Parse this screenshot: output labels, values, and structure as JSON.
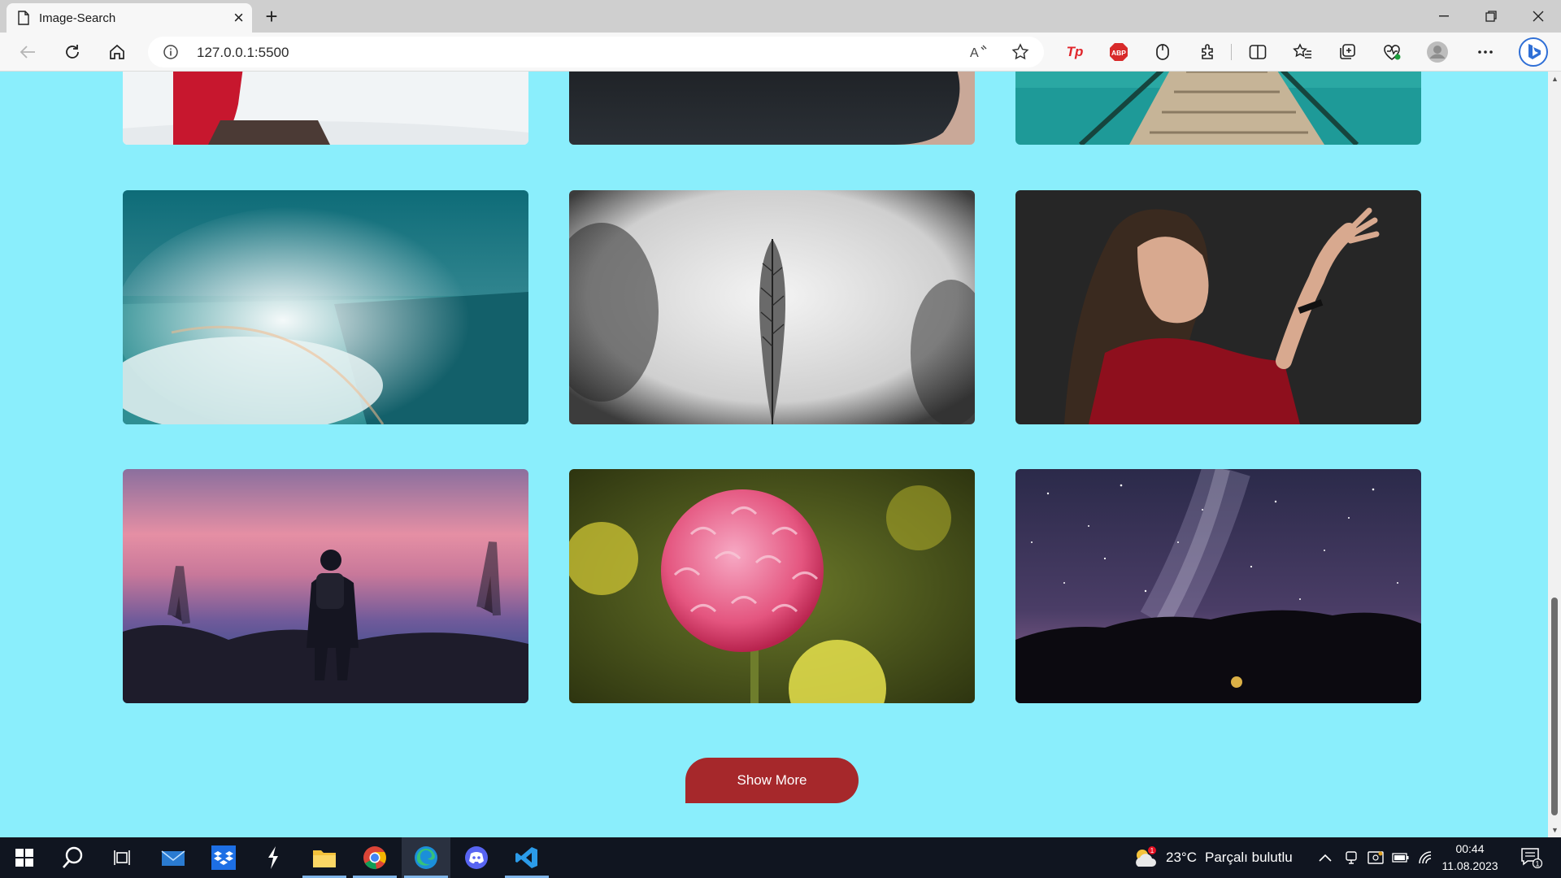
{
  "browser": {
    "tab_title": "Image-Search",
    "url": "127.0.0.1:5500",
    "extension_labels": {
      "tp": "Tp",
      "abp": "ABP"
    }
  },
  "page": {
    "background": "#8aeefc",
    "button_color": "#a6282b",
    "show_more_label": "Show More",
    "images": [
      {
        "name": "image-red-jacket-snow",
        "row": 0,
        "col": 0
      },
      {
        "name": "image-dark-rock-water",
        "row": 0,
        "col": 1
      },
      {
        "name": "image-wooden-pier-sea",
        "row": 0,
        "col": 2
      },
      {
        "name": "image-waterfall-rainbow",
        "row": 1,
        "col": 0
      },
      {
        "name": "image-feather-bw",
        "row": 1,
        "col": 1
      },
      {
        "name": "image-woman-reaching-hand",
        "row": 1,
        "col": 2
      },
      {
        "name": "image-hiker-silhouette-sunset",
        "row": 2,
        "col": 0
      },
      {
        "name": "image-pink-dahlia",
        "row": 2,
        "col": 1
      },
      {
        "name": "image-milky-way-night",
        "row": 2,
        "col": 2
      }
    ]
  },
  "taskbar": {
    "weather_temp": "23°C",
    "weather_text": "Parçalı bulutlu",
    "time": "00:44",
    "date": "11.08.2023",
    "weather_badge": "1",
    "notification_count": "1",
    "apps": [
      "start-icon",
      "search-icon",
      "task-view-icon",
      "mail-icon",
      "dropbox-icon",
      "sigil-icon",
      "file-explorer-icon",
      "chrome-icon",
      "edge-icon",
      "discord-icon",
      "vscode-icon"
    ]
  }
}
